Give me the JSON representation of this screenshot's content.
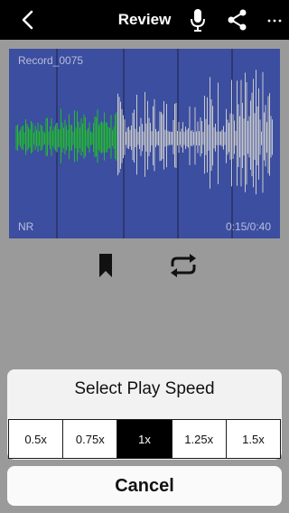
{
  "nav": {
    "title": "Review",
    "back_icon": "chevron-left-icon",
    "mic_icon": "microphone-icon",
    "share_icon": "share-icon",
    "more_icon": "ellipsis-icon"
  },
  "waveform": {
    "recording_name": "Record_0075",
    "nr_label": "NR",
    "time": "0:15/0:40",
    "played_color": "#1fbe2a",
    "unplayed_color": "#c9c9c9",
    "background_color": "#3c4ea0",
    "progress_fraction": 0.375
  },
  "controls": {
    "bookmark_icon": "bookmark-icon",
    "repeat_icon": "repeat-icon"
  },
  "speed_sheet": {
    "title": "Select Play Speed",
    "options": [
      "0.5x",
      "0.75x",
      "1x",
      "1.25x",
      "1.5x"
    ],
    "selected": "1x"
  },
  "cancel_label": "Cancel"
}
